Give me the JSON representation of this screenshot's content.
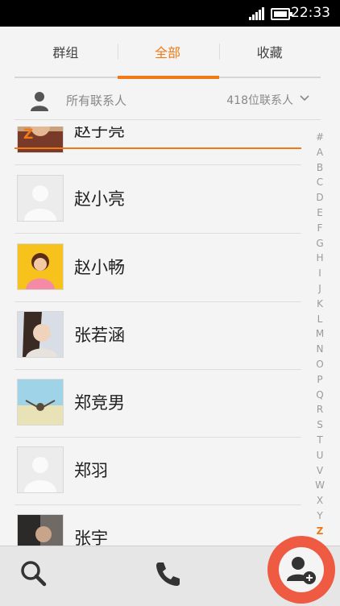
{
  "status_bar": {
    "time": "22:33"
  },
  "tabs": [
    {
      "label": "群组",
      "active": false
    },
    {
      "label": "全部",
      "active": true
    },
    {
      "label": "收藏",
      "active": false
    }
  ],
  "filter": {
    "label": "所有联系人",
    "count": "418位联系人"
  },
  "section_letter": "Z",
  "contacts": [
    {
      "name": "赵子亮",
      "avatar": "photo-warm"
    },
    {
      "name": "赵小亮",
      "avatar": "default"
    },
    {
      "name": "赵小畅",
      "avatar": "photo-yellow"
    },
    {
      "name": "张若涵",
      "avatar": "photo-portrait"
    },
    {
      "name": "郑竞男",
      "avatar": "photo-sky"
    },
    {
      "name": "郑羽",
      "avatar": "default"
    },
    {
      "name": "张宇",
      "avatar": "photo-dark"
    }
  ],
  "alphabet": [
    "#",
    "A",
    "B",
    "C",
    "D",
    "E",
    "F",
    "G",
    "H",
    "I",
    "J",
    "K",
    "L",
    "M",
    "N",
    "O",
    "P",
    "Q",
    "R",
    "S",
    "T",
    "U",
    "V",
    "W",
    "X",
    "Y",
    "Z"
  ],
  "alphabet_active": "Z",
  "accent_color": "#f07a16",
  "add_button_color": "#ef5a43",
  "icons": {
    "search": "search-icon",
    "call": "phone-icon",
    "add": "add-contact-icon"
  }
}
